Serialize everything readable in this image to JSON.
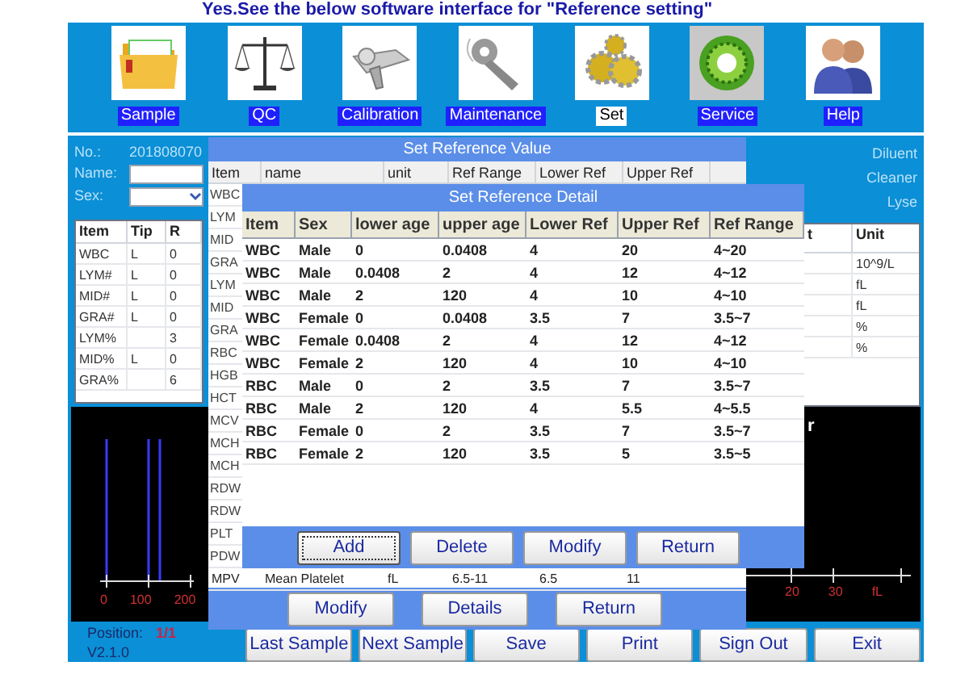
{
  "heading": "Yes.See the below software interface for \"Reference setting\"",
  "toolbar": [
    {
      "label": "Sample",
      "kind": "folder",
      "selected": false
    },
    {
      "label": "QC",
      "kind": "scale",
      "selected": false
    },
    {
      "label": "Calibration",
      "kind": "device",
      "selected": false
    },
    {
      "label": "Maintenance",
      "kind": "wrench",
      "selected": false
    },
    {
      "label": "Set",
      "kind": "gears",
      "selected": true
    },
    {
      "label": "Service",
      "kind": "dial",
      "selected": false
    },
    {
      "label": "Help",
      "kind": "people",
      "selected": false
    }
  ],
  "sample_info": {
    "no_label": "No.:",
    "no_value": "201808070",
    "name_label": "Name:",
    "sex_label": "Sex:"
  },
  "results_table": {
    "columns": [
      "Item",
      "Tip",
      "R"
    ],
    "rows": [
      [
        "WBC",
        "L",
        "0"
      ],
      [
        "LYM#",
        "L",
        "0"
      ],
      [
        "MID#",
        "L",
        "0"
      ],
      [
        "GRA#",
        "L",
        "0"
      ],
      [
        "LYM%",
        null,
        "3"
      ],
      [
        "MID%",
        "L",
        "0"
      ],
      [
        "GRA%",
        null,
        "6"
      ]
    ]
  },
  "reagents": [
    "Diluent",
    "Cleaner",
    "Lyse"
  ],
  "units_table": {
    "columns": [
      "t",
      "Unit"
    ],
    "rows": [
      "10^9/L",
      "fL",
      "fL",
      "%",
      "%"
    ]
  },
  "histograms": {
    "left_ticks": [
      "0",
      "100",
      "200"
    ],
    "right_label": "r",
    "right_ticks": [
      "20",
      "30",
      "fL"
    ]
  },
  "status": {
    "position_label": "Position:",
    "position_value": "1/1",
    "version": "V2.1.0"
  },
  "bottom_buttons": [
    "Last Sample",
    "Next Sample",
    "Save",
    "Print",
    "Sign Out",
    "Exit"
  ],
  "reference_value_dialog": {
    "title": "Set Reference Value",
    "columns": [
      "Item",
      "name",
      "unit",
      "Ref Range",
      "Lower Ref",
      "Upper Ref"
    ],
    "items": [
      "WBC",
      "LYM",
      "MID",
      "GRA",
      "LYM",
      "MID",
      "GRA",
      "RBC",
      "HGB",
      "HCT",
      "MCV",
      "MCH",
      "MCH",
      "RDW",
      "RDW",
      "PLT",
      "PDW"
    ],
    "last_row": [
      "MPV",
      "Mean Platelet",
      "fL",
      "6.5-11",
      "6.5",
      "11"
    ],
    "buttons": [
      "Modify",
      "Details",
      "Return"
    ]
  },
  "reference_detail_dialog": {
    "title": "Set Reference Detail",
    "columns": [
      "Item",
      "Sex",
      "lower age",
      "upper age",
      "Lower Ref",
      "Upper Ref",
      "Ref Range"
    ],
    "rows": [
      [
        "WBC",
        "Male",
        "0",
        "0.0408",
        "4",
        "20",
        "4~20"
      ],
      [
        "WBC",
        "Male",
        "0.0408",
        "2",
        "4",
        "12",
        "4~12"
      ],
      [
        "WBC",
        "Male",
        "2",
        "120",
        "4",
        "10",
        "4~10"
      ],
      [
        "WBC",
        "Female",
        "0",
        "0.0408",
        "3.5",
        "7",
        "3.5~7"
      ],
      [
        "WBC",
        "Female",
        "0.0408",
        "2",
        "4",
        "12",
        "4~12"
      ],
      [
        "WBC",
        "Female",
        "2",
        "120",
        "4",
        "10",
        "4~10"
      ],
      [
        "RBC",
        "Male",
        "0",
        "2",
        "3.5",
        "7",
        "3.5~7"
      ],
      [
        "RBC",
        "Male",
        "2",
        "120",
        "4",
        "5.5",
        "4~5.5"
      ],
      [
        "RBC",
        "Female",
        "0",
        "2",
        "3.5",
        "7",
        "3.5~7"
      ],
      [
        "RBC",
        "Female",
        "2",
        "120",
        "3.5",
        "5",
        "3.5~5"
      ]
    ],
    "buttons": [
      {
        "label": "Add",
        "selected": true
      },
      {
        "label": "Delete",
        "selected": false
      },
      {
        "label": "Modify",
        "selected": false
      },
      {
        "label": "Return",
        "selected": false
      }
    ]
  }
}
